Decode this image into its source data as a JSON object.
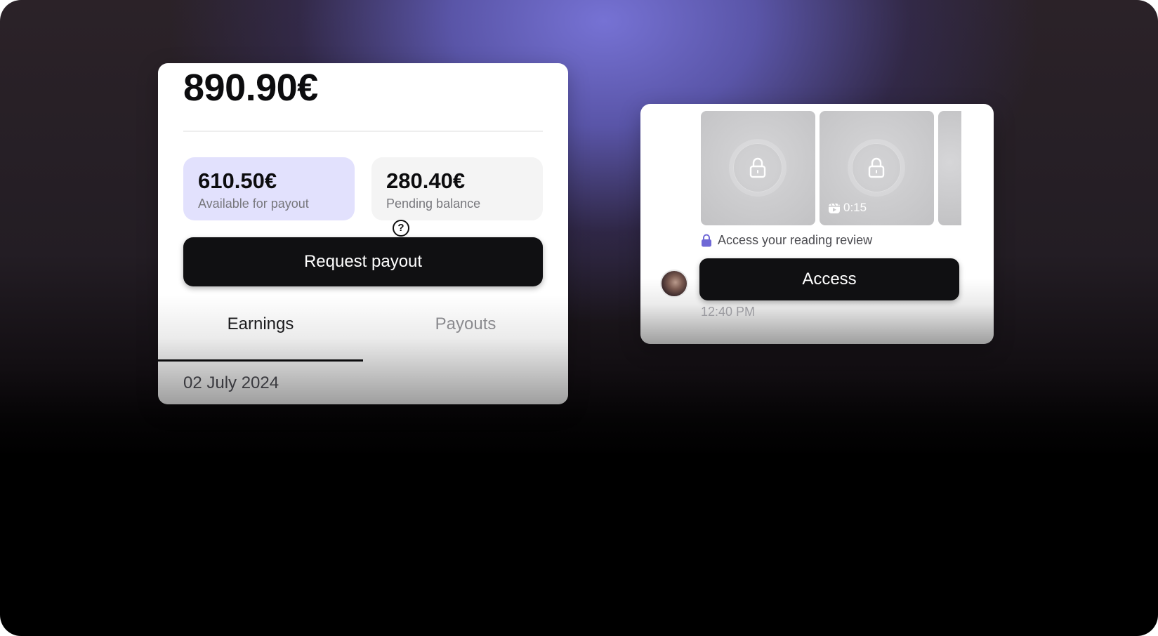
{
  "earnings_card": {
    "total_amount": "890.90€",
    "available": {
      "amount": "610.50€",
      "label": "Available for payout"
    },
    "pending": {
      "amount": "280.40€",
      "label": "Pending balance"
    },
    "help_symbol": "?",
    "request_payout_label": "Request payout",
    "tabs": [
      {
        "label": "Earnings",
        "active": true
      },
      {
        "label": "Payouts",
        "active": false
      }
    ],
    "date": "02 July 2024"
  },
  "chat_card": {
    "thumbnails": [
      {
        "icon": "lock-icon"
      },
      {
        "icon": "lock-icon",
        "duration": "0:15"
      },
      {
        "icon": "partial-thumbnail"
      }
    ],
    "locked_text": "Access your reading review",
    "access_label": "Access",
    "time": "12:40 PM"
  },
  "colors": {
    "accent_purple": "#7672d4",
    "available_bg": "#e2e1fd",
    "pending_bg": "#f4f4f4",
    "button_bg": "#101012",
    "lock_icon": "#6f68d6"
  }
}
